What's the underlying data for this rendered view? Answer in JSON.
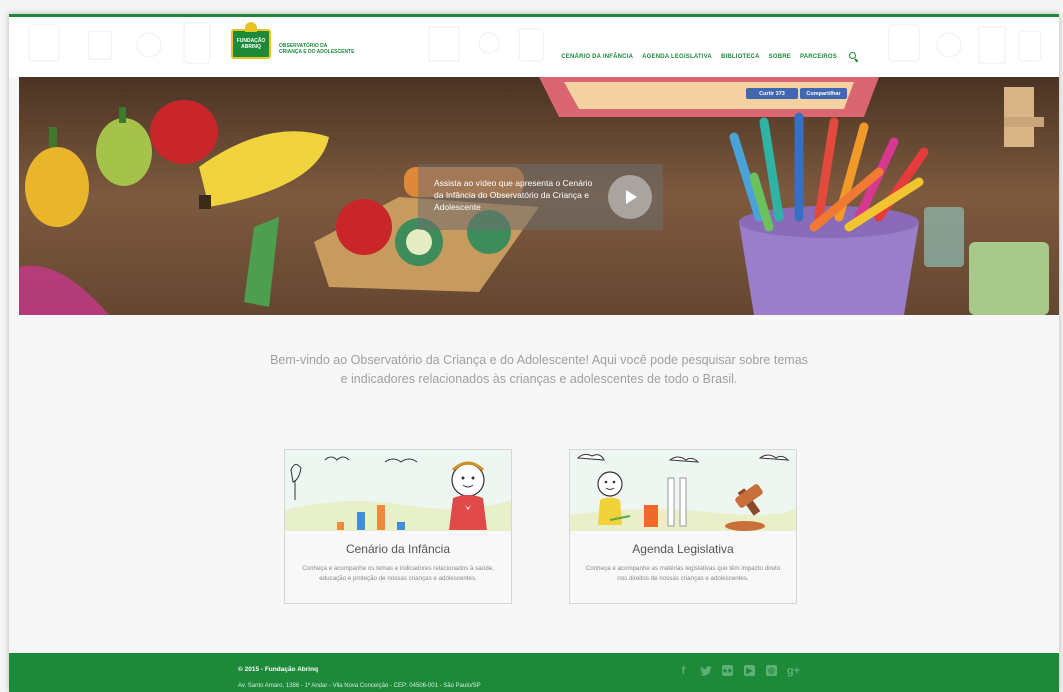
{
  "header": {
    "logo_text": "FUNDAÇÃO ABRINQ",
    "brand_line1": "OBSERVATÓRIO DA",
    "brand_line2": "CRIANÇA E DO ADOLESCENTE",
    "nav": [
      {
        "label": "CENÁRIO DA INFÂNCIA"
      },
      {
        "label": "AGENDA LEGISLATIVA"
      },
      {
        "label": "BIBLIOTECA"
      },
      {
        "label": "SOBRE"
      },
      {
        "label": "PARCEIROS"
      }
    ],
    "search_icon": "search-icon"
  },
  "hero": {
    "fb_like": "Curtir 373",
    "fb_share": "Compartilhar",
    "video_text": "Assista ao vídeo que apresenta o Cenário da Infância do Observatório da Criança e Adolescente"
  },
  "welcome": {
    "text": "Bem-vindo ao Observatório da Criança e do Adolescente! Aqui você pode pesquisar sobre temas e indicadores relacionados às crianças e adolescentes de todo o Brasil."
  },
  "cards": [
    {
      "title": "Cenário da Infância",
      "description": "Conheça e acompanhe os temas e indicadores relacionados à saúde, educação e proteção de nossas crianças e adolescentes."
    },
    {
      "title": "Agenda Legislativa",
      "description": "Conheça e acompanhe as matérias legislativas que têm impacto direto nos direitos de nossas crianças e adolescentes."
    }
  ],
  "footer": {
    "copyright": "© 2015 - Fundação Abrinq",
    "address": "Av. Santo Amaro, 1386 - 1º Andar - Vila Nova Conceição - CEP: 04506-001 - São Paulo/SP",
    "social": [
      "facebook-icon",
      "twitter-icon",
      "flickr-icon",
      "youtube-icon",
      "instagram-icon",
      "google-plus-icon"
    ]
  },
  "colors": {
    "brand_green": "#1d8a3a",
    "facebook_blue": "#4267b2"
  }
}
